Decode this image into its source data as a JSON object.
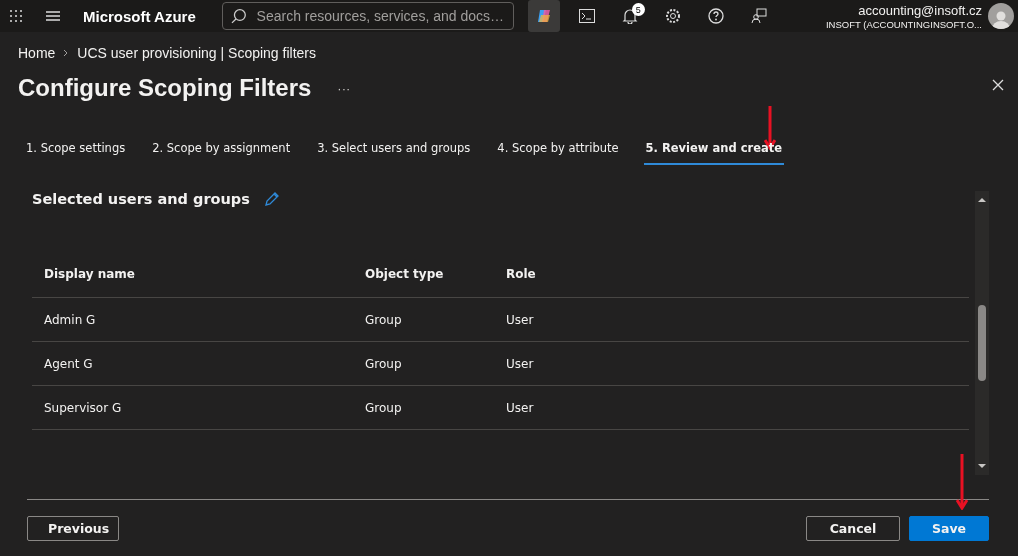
{
  "top_bar": {
    "brand": "Microsoft Azure",
    "search": {
      "placeholder": "Search resources, services, and docs…"
    },
    "notifications_count": "5",
    "account": {
      "email": "accounting@insoft.cz",
      "tenant": "INSOFT (ACCOUNTINGINSOFT.O..."
    }
  },
  "breadcrumb": [
    "Home",
    "UCS user provisioning | Scoping filters"
  ],
  "title": "Configure Scoping Filters",
  "more": "···",
  "tabs": [
    {
      "label": "1. Scope settings",
      "selected": false
    },
    {
      "label": "2. Scope by assignment",
      "selected": false
    },
    {
      "label": "3. Select users and groups",
      "selected": false
    },
    {
      "label": "4. Scope by attribute",
      "selected": false
    },
    {
      "label": "5. Review and create",
      "selected": true
    }
  ],
  "section": {
    "heading": "Selected users and groups"
  },
  "table": {
    "columns": [
      "Display name",
      "Object type",
      "Role"
    ],
    "rows": [
      [
        "Admin G",
        "Group",
        "User"
      ],
      [
        "Agent G",
        "Group",
        "User"
      ],
      [
        "Supervisor G",
        "Group",
        "User"
      ]
    ]
  },
  "buttons": {
    "previous": "Previous",
    "cancel": "Cancel",
    "save": "Save"
  }
}
